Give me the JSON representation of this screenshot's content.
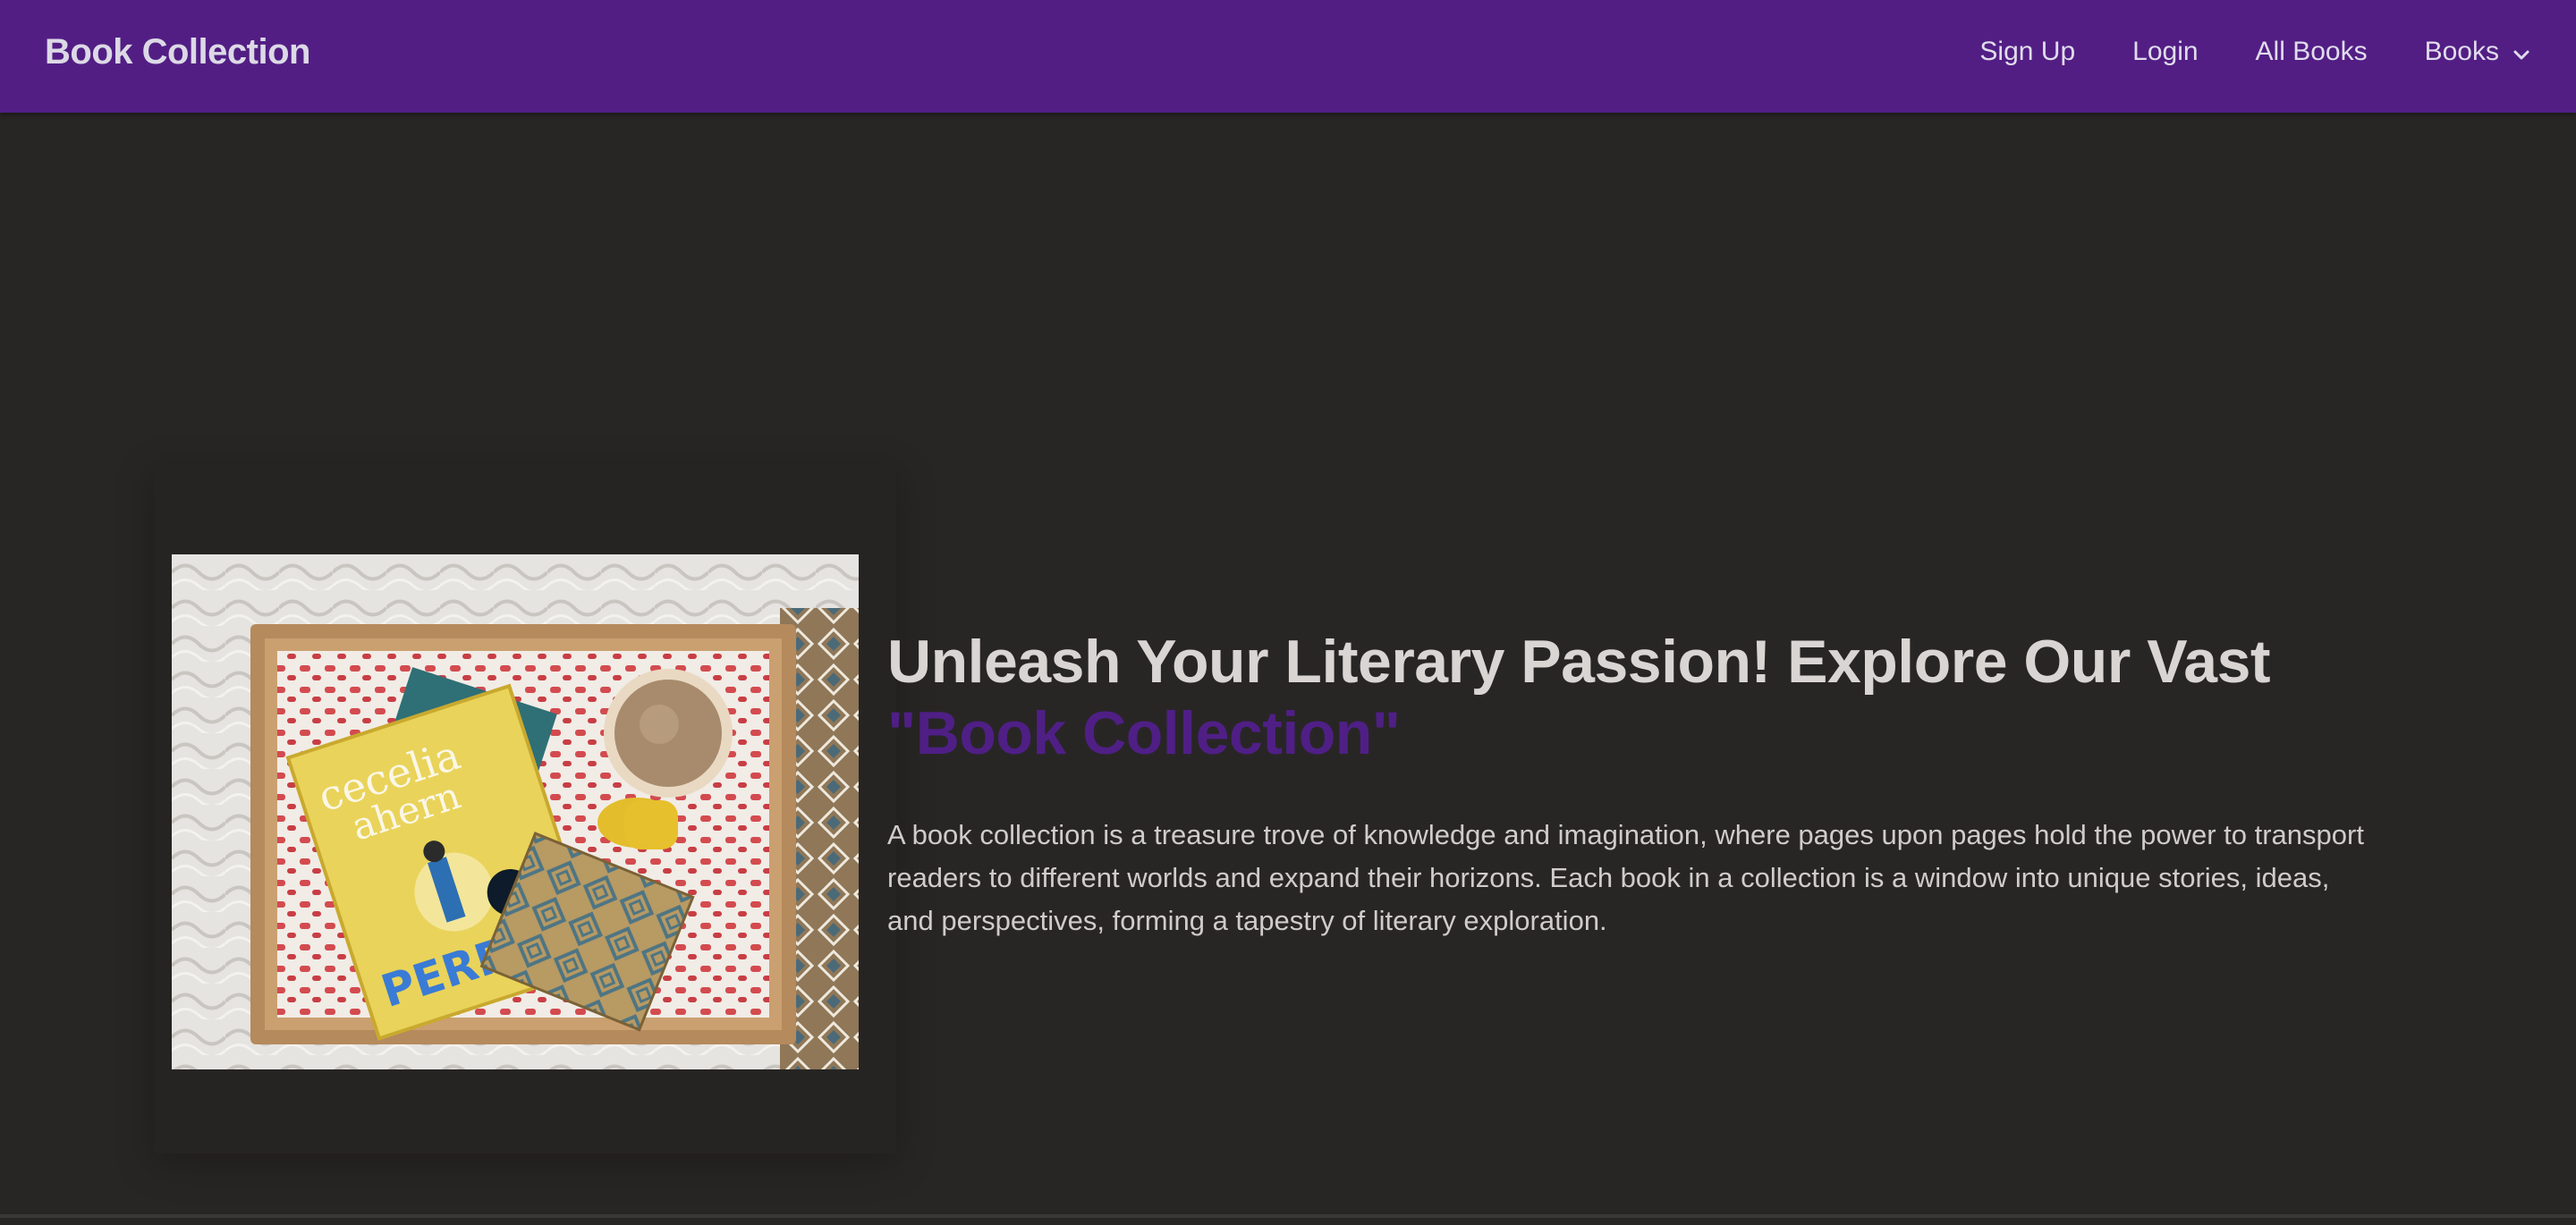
{
  "navbar": {
    "brand": "Book Collection",
    "links": [
      {
        "label": "Sign Up"
      },
      {
        "label": "Login"
      },
      {
        "label": "All Books"
      },
      {
        "label": "Books"
      }
    ]
  },
  "hero": {
    "headline": "Unleash Your Literary Passion! Explore Our Vast",
    "headline_accent": "\"Book Collection\"",
    "description": "A book collection is a treasure trove of knowledge and imagination, where pages upon pages hold the power to transport readers to different worlds and expand their horizons. Each book in a collection is a window into unique stories, ideas, and perspectives, forming a tapestry of literary exploration.",
    "image": {
      "book_title": "PERFECT",
      "book_author": "cecelia ahern"
    }
  },
  "colors": {
    "navbar_bg": "#521e84",
    "page_bg": "#282625",
    "accent": "#4f1f86"
  }
}
